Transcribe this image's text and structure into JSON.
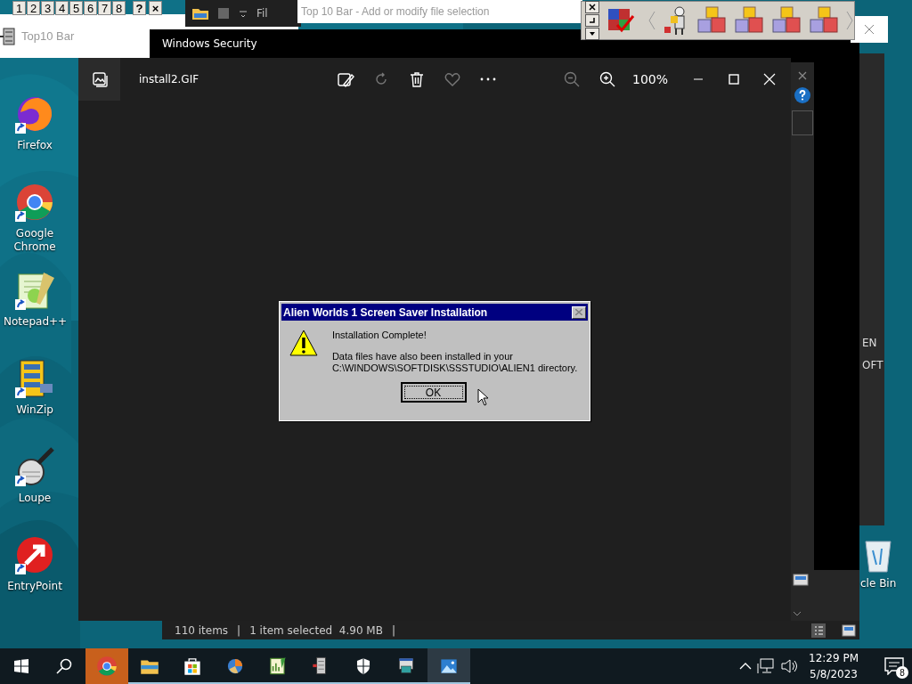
{
  "top10_bar": {
    "buttons": [
      {
        "label": "1"
      },
      {
        "label": "2"
      },
      {
        "label": "3"
      },
      {
        "label": "4"
      },
      {
        "label": "5"
      },
      {
        "label": "6"
      },
      {
        "label": "7"
      },
      {
        "label": "8"
      }
    ],
    "help": "?",
    "close": "×"
  },
  "top10_window": {
    "title": "Top10 Bar"
  },
  "explorer_toolbar": {
    "menu_fragment": "Fil"
  },
  "file_selection_window": {
    "title": "Top 10 Bar - Add or modify file selection"
  },
  "security_window": {
    "title": "Windows Security"
  },
  "photo_viewer": {
    "file_name": "install2.GIF",
    "zoom": "100%"
  },
  "dialog": {
    "title": "Alien Worlds 1 Screen Saver Installation",
    "heading": "Installation Complete!",
    "message": "Data files have also been installed in your C:\\WINDOWS\\SOFTDISK\\SSSTUDIO\\ALIEN1 directory.",
    "button": "OK"
  },
  "background_window": {
    "fragments": [
      "EN",
      "OFT"
    ]
  },
  "explorer_status": {
    "items": "110 items",
    "selection": "1 item selected",
    "size": "4.90 MB",
    "separator": "|"
  },
  "desktop_icons": [
    {
      "label": "Firefox",
      "kind": "firefox"
    },
    {
      "label": "Google Chrome",
      "kind": "chrome"
    },
    {
      "label": "Notepad++",
      "kind": "notepad"
    },
    {
      "label": "WinZip",
      "kind": "winzip"
    },
    {
      "label": "Loupe",
      "kind": "loupe"
    },
    {
      "label": "EntryPoint",
      "kind": "entrypoint"
    }
  ],
  "recycle_bin": {
    "label": "cle Bin"
  },
  "taskbar": {
    "apps": [
      {
        "kind": "chrome",
        "flashing": true,
        "selected": false,
        "running": false
      },
      {
        "kind": "explorer",
        "flashing": false,
        "selected": false,
        "running": true
      },
      {
        "kind": "store",
        "flashing": false,
        "selected": false,
        "running": true
      },
      {
        "kind": "orb",
        "flashing": false,
        "selected": false,
        "running": true
      },
      {
        "kind": "chart",
        "flashing": false,
        "selected": false,
        "running": true
      },
      {
        "kind": "cabinet",
        "flashing": false,
        "selected": false,
        "running": true
      },
      {
        "kind": "shield",
        "flashing": false,
        "selected": false,
        "running": true
      },
      {
        "kind": "installer",
        "flashing": false,
        "selected": false,
        "running": true
      },
      {
        "kind": "photos",
        "flashing": false,
        "selected": true,
        "running": true
      }
    ],
    "time": "12:29 PM",
    "date": "5/8/2023",
    "notification_count": "8"
  }
}
